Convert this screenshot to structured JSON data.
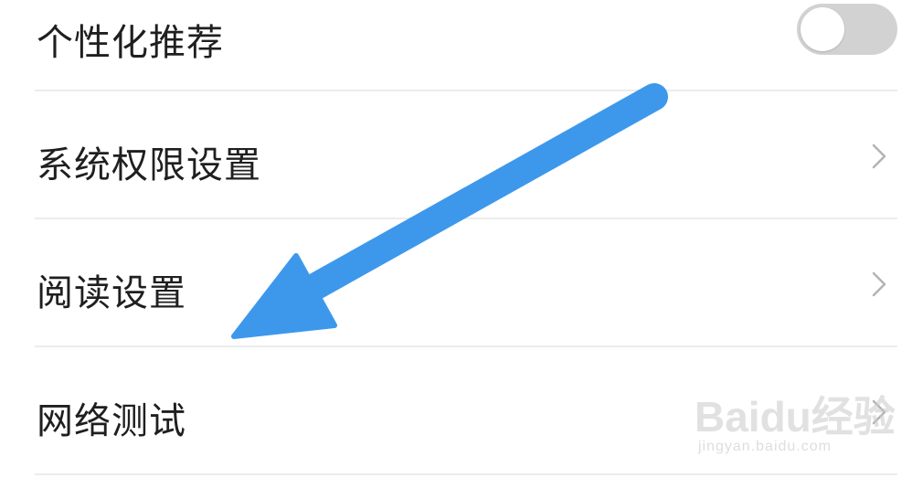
{
  "settings": {
    "items": [
      {
        "label": "个性化推荐",
        "control": "toggle",
        "toggle_on": false
      },
      {
        "label": "系统权限设置",
        "control": "chevron"
      },
      {
        "label": "阅读设置",
        "control": "chevron"
      },
      {
        "label": "网络测试",
        "control": "chevron"
      }
    ]
  },
  "annotation": {
    "icon": "arrow-icon",
    "color": "#3d98ec"
  },
  "watermark": {
    "logo_text": "Baidu经验",
    "sub_text": "jingyan.baidu.com"
  },
  "colors": {
    "divider": "#ececec",
    "toggle_off_track": "#d2d2d2",
    "chevron": "#b3b3b3",
    "text": "#1f1f1f"
  }
}
